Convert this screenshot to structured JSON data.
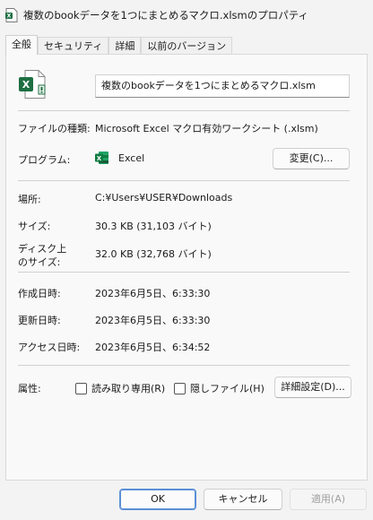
{
  "window": {
    "title": "複数のbookデータを1つにまとめるマクロ.xlsmのプロパティ"
  },
  "tabs": [
    {
      "label": "全般",
      "active": true
    },
    {
      "label": "セキュリティ",
      "active": false
    },
    {
      "label": "詳細",
      "active": false
    },
    {
      "label": "以前のバージョン",
      "active": false
    }
  ],
  "general": {
    "file_name": "複数のbookデータを1つにまとめるマクロ.xlsm",
    "file_type_label": "ファイルの種類:",
    "file_type_value": "Microsoft Excel マクロ有効ワークシート (.xlsm)",
    "program_label": "プログラム:",
    "program_value": "Excel",
    "change_button": "変更(C)...",
    "location_label": "場所:",
    "location_value": "C:¥Users¥USER¥Downloads",
    "size_label": "サイズ:",
    "size_value": "30.3 KB (31,103 バイト)",
    "disk_size_label_line1": "ディスク上",
    "disk_size_label_line2": "のサイズ:",
    "disk_size_value": "32.0 KB (32,768 バイト)",
    "created_label": "作成日時:",
    "created_value": "2023年6月5日、6:33:30",
    "modified_label": "更新日時:",
    "modified_value": "2023年6月5日、6:33:30",
    "accessed_label": "アクセス日時:",
    "accessed_value": "2023年6月5日、6:34:52",
    "attributes_label": "属性:",
    "readonly_label": "読み取り専用(R)",
    "readonly_checked": false,
    "hidden_label": "隠しファイル(H)",
    "hidden_checked": false,
    "advanced_button": "詳細設定(D)..."
  },
  "footer": {
    "ok": "OK",
    "cancel": "キャンセル",
    "apply": "適用(A)"
  },
  "colors": {
    "excel_green": "#1d6f42",
    "excel_dark": "#185c37",
    "ok_border": "#5b8fd6"
  }
}
